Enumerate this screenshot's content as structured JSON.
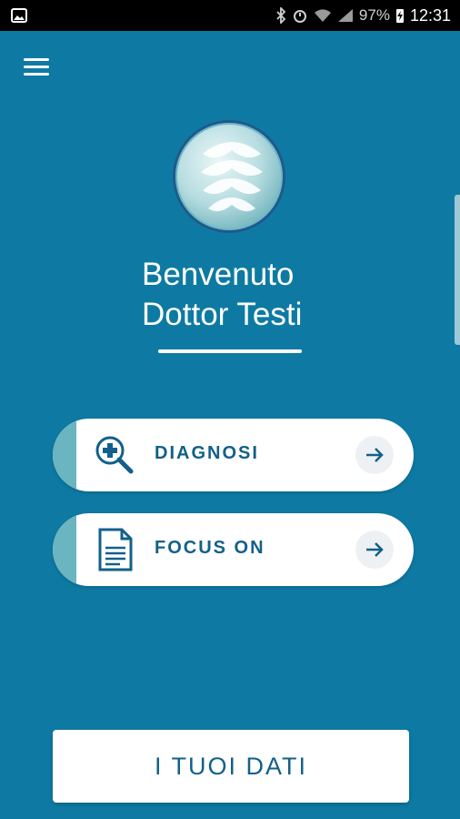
{
  "status_bar": {
    "battery": "97%",
    "time": "12:31"
  },
  "menu": {
    "icon": "hamburger-menu-icon"
  },
  "logo": {
    "icon": "spine-logo-icon"
  },
  "greeting": {
    "line1": "Benvenuto",
    "line2": "Dottor Testi"
  },
  "cards": [
    {
      "label": "DIAGNOSI",
      "icon": "magnifier-plus-icon"
    },
    {
      "label": "FOCUS ON",
      "icon": "document-icon"
    }
  ],
  "data_button": {
    "label": "I TUOI DATI"
  },
  "colors": {
    "background": "#0e7aa3",
    "accent_stripe": "#6ab5bf",
    "text_primary": "#12608a"
  }
}
